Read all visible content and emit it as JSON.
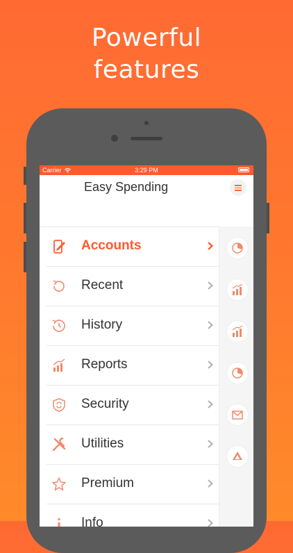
{
  "promo": {
    "line1": "Powerful",
    "line2": "features"
  },
  "statusbar": {
    "carrier": "Carrier",
    "time": "3:29 PM"
  },
  "app": {
    "title": "Easy Spending"
  },
  "colors": {
    "accent": "#ff5a2d",
    "background_top": "#ff6a33",
    "background_bottom": "#ff8a2a"
  },
  "menu": {
    "items": [
      {
        "label": "Accounts",
        "icon": "phone-edit-icon",
        "active": true
      },
      {
        "label": "Recent",
        "icon": "refresh-icon"
      },
      {
        "label": "History",
        "icon": "clock-history-icon"
      },
      {
        "label": "Reports",
        "icon": "bar-chart-up-icon"
      },
      {
        "label": "Security",
        "icon": "shield-refresh-icon"
      },
      {
        "label": "Utilities",
        "icon": "tools-icon"
      },
      {
        "label": "Premium",
        "icon": "star-icon"
      },
      {
        "label": "Info",
        "icon": "info-icon"
      }
    ]
  },
  "side_shortcuts": [
    "pie-chart-icon",
    "bar-chart-up-icon",
    "bar-chart-up-icon",
    "pie-chart-icon",
    "mail-icon",
    "drive-icon"
  ]
}
